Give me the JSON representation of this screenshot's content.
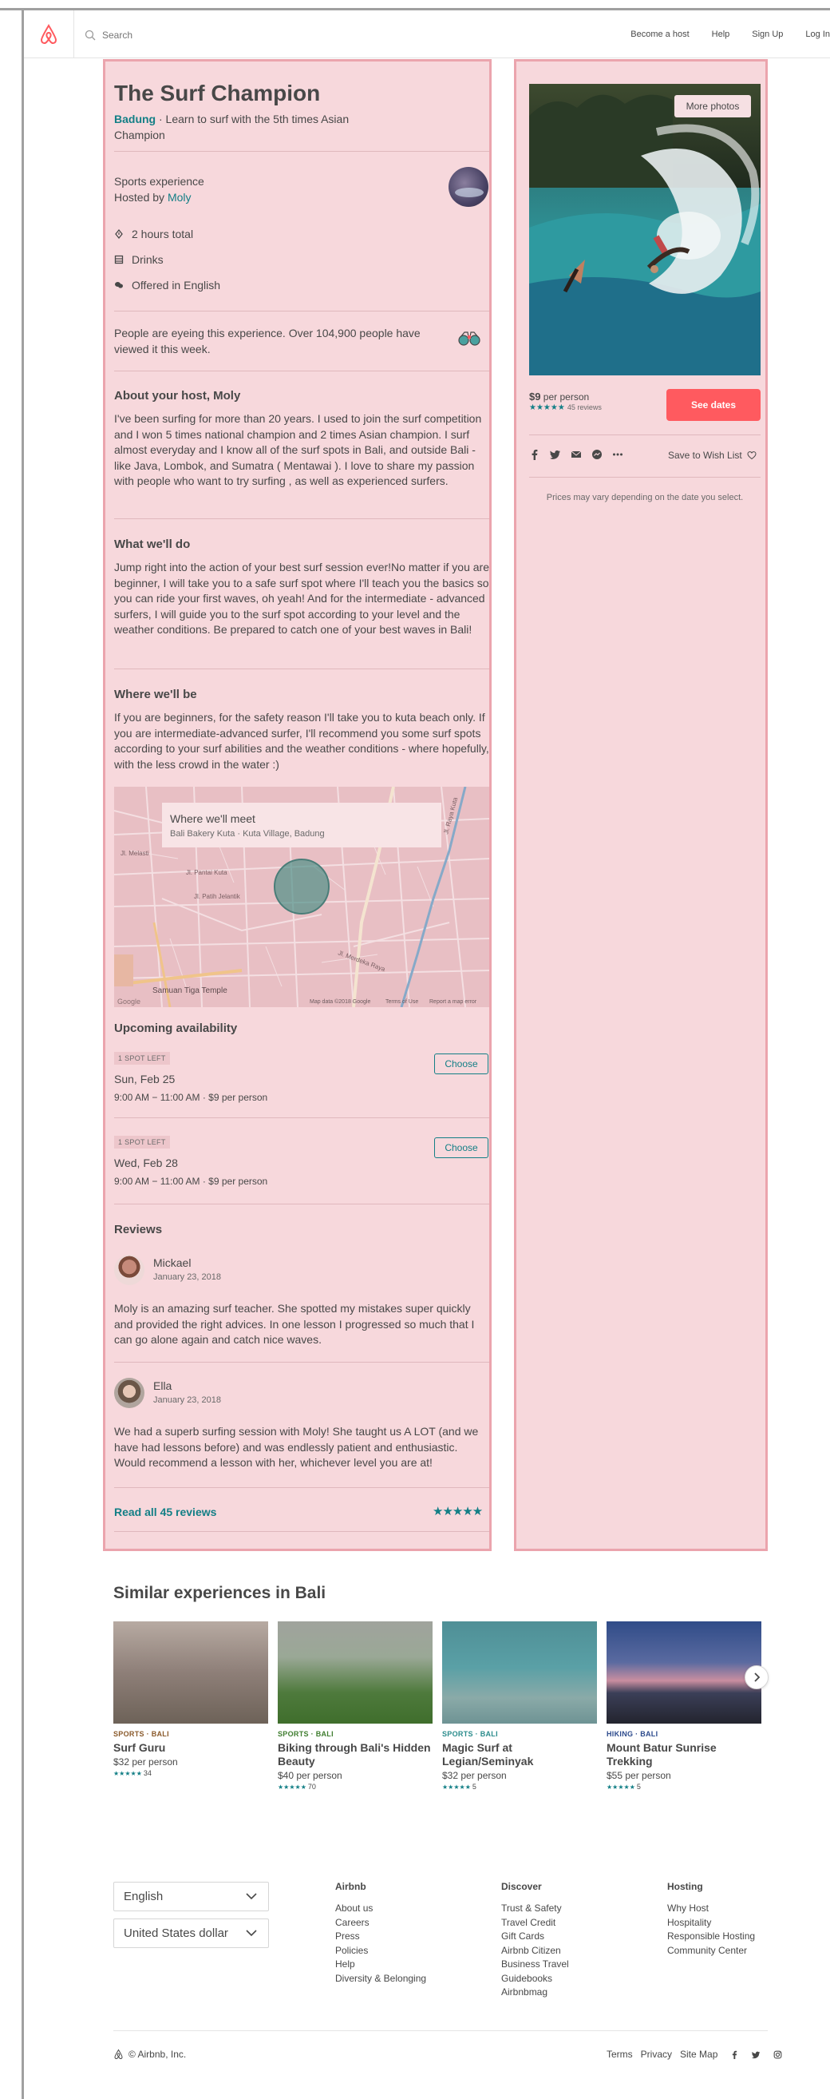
{
  "header": {
    "search_placeholder": "Search",
    "nav": [
      "Become a host",
      "Help",
      "Sign Up",
      "Log In"
    ]
  },
  "experience": {
    "title": "The Surf Champion",
    "location": "Badung",
    "subtitle_rest": " · Learn to surf with the 5th times Asian Champion",
    "type": "Sports experience",
    "hosted_by_prefix": "Hosted by ",
    "host_name": "Moly",
    "features": [
      "2 hours total",
      "Drinks",
      "Offered in English"
    ],
    "eyeing": "People are eyeing this experience. Over 104,900 people have viewed it this week."
  },
  "about_host": {
    "heading": "About your host, Moly",
    "text": "I've been surfing for more than 20 years. I used to join the surf competition and I won 5 times national champion and 2 times Asian champion. I surf almost everyday and I know all of the surf spots in Bali, and outside Bali - like Java, Lombok, and Sumatra ( Mentawai ). I love to share my passion with people who want to try surfing , as well as experienced surfers."
  },
  "what_we_do": {
    "heading": "What we'll do",
    "text": "Jump right into the action of your best surf session ever!No matter if you are beginner, I will take you to a safe surf spot where I'll teach you the basics so you can ride your first waves, oh yeah! And for the intermediate - advanced surfers, I will guide you to the surf spot according to your level and the weather conditions. Be prepared to catch one of your best waves in Bali!"
  },
  "where_we_be": {
    "heading": "Where we'll be",
    "text": "If you are beginners, for the safety reason I'll take you to kuta beach only. If you are intermediate-advanced surfer, I'll recommend you some surf spots according to your surf abilities and the weather conditions - where hopefully, with the less crowd in the water :)"
  },
  "map": {
    "card_title": "Where we'll meet",
    "card_address": "Bali Bakery Kuta · Kuta Village, Badung",
    "temple_label": "Samuan Tiga Temple",
    "street_labels": [
      "Jl. Patih Jelantik",
      "Jl. Melasti",
      "Jl. Pantai Kuta",
      "Jl. Merdeka Raya",
      "Jl. Raya Kuta"
    ],
    "google": "Google",
    "map_data": "Map data ©2018 Google",
    "terms": "Terms of Use",
    "report": "Report a map error"
  },
  "availability": {
    "heading": "Upcoming availability",
    "slots": [
      {
        "badge": "1 SPOT LEFT",
        "date": "Sun, Feb 25",
        "time": "9:00 AM − 11:00 AM · $9 per person",
        "button": "Choose"
      },
      {
        "badge": "1 SPOT LEFT",
        "date": "Wed, Feb 28",
        "time": "9:00 AM − 11:00 AM · $9 per person",
        "button": "Choose"
      }
    ]
  },
  "reviews": {
    "heading": "Reviews",
    "items": [
      {
        "name": "Mickael",
        "date": "January 23, 2018",
        "text": "Moly is an amazing surf teacher. She spotted my mistakes super quickly and provided the right advices. In one lesson I progressed so much that I can go alone again and catch nice waves."
      },
      {
        "name": "Ella",
        "date": "January 23, 2018",
        "text": "We had a superb surfing session with Moly! She taught us A LOT (and we have had lessons before) and was endlessly patient and enthusiastic. Would recommend a lesson with her, whichever level you are at!"
      }
    ],
    "read_all": "Read all 45 reviews",
    "stars": "★★★★★"
  },
  "booking": {
    "more_photos": "More photos",
    "price": "$9",
    "per_person": " per person",
    "stars": "★★★★★",
    "review_count": "45 reviews",
    "see_dates": "See dates",
    "save_wishlist": "Save to Wish List",
    "price_note": "Prices may vary depending on the date you select."
  },
  "similar": {
    "heading": "Similar experiences in Bali",
    "cards": [
      {
        "category": "SPORTS · BALI",
        "cat_color": "#8a5a2b",
        "name": "Surf Guru",
        "price": "$32 per person",
        "stars": "★★★★★",
        "count": "34"
      },
      {
        "category": "SPORTS · BALI",
        "cat_color": "#3f7d2f",
        "name": "Biking through Bali's Hidden Beauty",
        "price": "$40 per person",
        "stars": "★★★★★",
        "count": "70"
      },
      {
        "category": "SPORTS · BALI",
        "cat_color": "#2a8c8c",
        "name": "Magic Surf at Legian/Seminyak",
        "price": "$32 per person",
        "stars": "★★★★★",
        "count": "5"
      },
      {
        "category": "HIKING · BALI",
        "cat_color": "#2c4a8c",
        "name": "Mount Batur Sunrise Trekking",
        "price": "$55 per person",
        "stars": "★★★★★",
        "count": "5"
      }
    ]
  },
  "footer": {
    "language": "English",
    "currency": "United States dollar",
    "columns": [
      {
        "heading": "Airbnb",
        "links": [
          "About us",
          "Careers",
          "Press",
          "Policies",
          "Help",
          "Diversity & Belonging"
        ]
      },
      {
        "heading": "Discover",
        "links": [
          "Trust & Safety",
          "Travel Credit",
          "Gift Cards",
          "Airbnb Citizen",
          "Business Travel",
          "Guidebooks",
          "Airbnbmag"
        ]
      },
      {
        "heading": "Hosting",
        "links": [
          "Why Host",
          "Hospitality",
          "Responsible Hosting",
          "Community Center"
        ]
      }
    ],
    "copyright": "© Airbnb, Inc.",
    "bottom_links": [
      "Terms",
      "Privacy",
      "Site Map"
    ]
  }
}
